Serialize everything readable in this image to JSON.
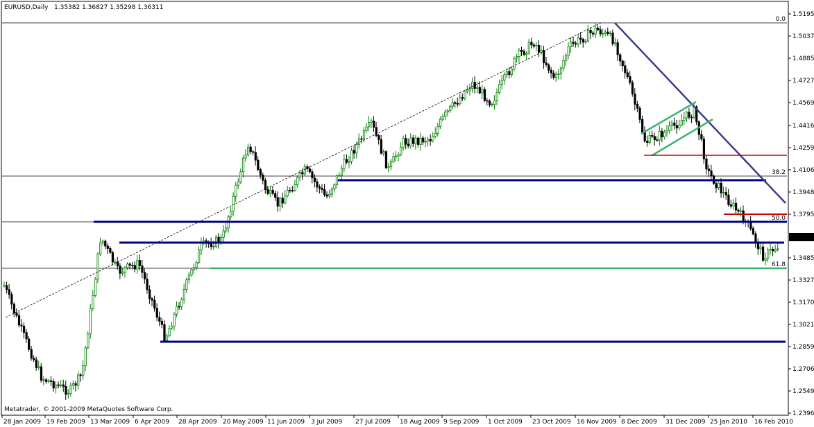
{
  "header": {
    "symbol_label": "EURUSD,Daily",
    "ohlc_text": "1.35382 1.36827 1.35298 1.36311"
  },
  "footer": {
    "copyright": "Metatrader, © 2001-2009 MetaQuotes Software Corp."
  },
  "chart_data": {
    "type": "candlestick",
    "ylim": [
      1.2396,
      1.5225
    ],
    "y_ticks": [
      "1.51950",
      "1.50375",
      "1.48855",
      "1.47270",
      "1.45695",
      "1.44165",
      "1.42590",
      "1.41060",
      "1.39485",
      "1.37955",
      "1.36311",
      "1.34850",
      "1.33275",
      "1.31700",
      "1.30215",
      "1.28595",
      "1.27065",
      "1.25490",
      "1.23960"
    ],
    "x_ticks": [
      "28 Jan 2009",
      "19 Feb 2009",
      "13 Mar 2009",
      "6 Apr 2009",
      "28 Apr 2009",
      "20 May 2009",
      "11 Jun 2009",
      "3 Jul 2009",
      "27 Jul 2009",
      "18 Aug 2009",
      "9 Sep 2009",
      "1 Oct 2009",
      "23 Oct 2009",
      "16 Nov 2009",
      "8 Dec 2009",
      "31 Dec 2009",
      "25 Jan 2010",
      "16 Feb 2010"
    ],
    "current_price": "1.36311",
    "fib_levels": [
      {
        "label": "0.0",
        "price": 1.5195
      },
      {
        "label": "38.2",
        "price": 1.4094
      },
      {
        "label": "50.0",
        "price": 1.3765
      },
      {
        "label": "61.8",
        "price": 1.3489
      }
    ],
    "colors": {
      "up": "#008000",
      "down": "#000000",
      "support": "#000080",
      "trendline": "#3b3b8c",
      "channel": "#3cb371",
      "resistance": "#d00000",
      "fib_green": "#3cb371"
    }
  }
}
